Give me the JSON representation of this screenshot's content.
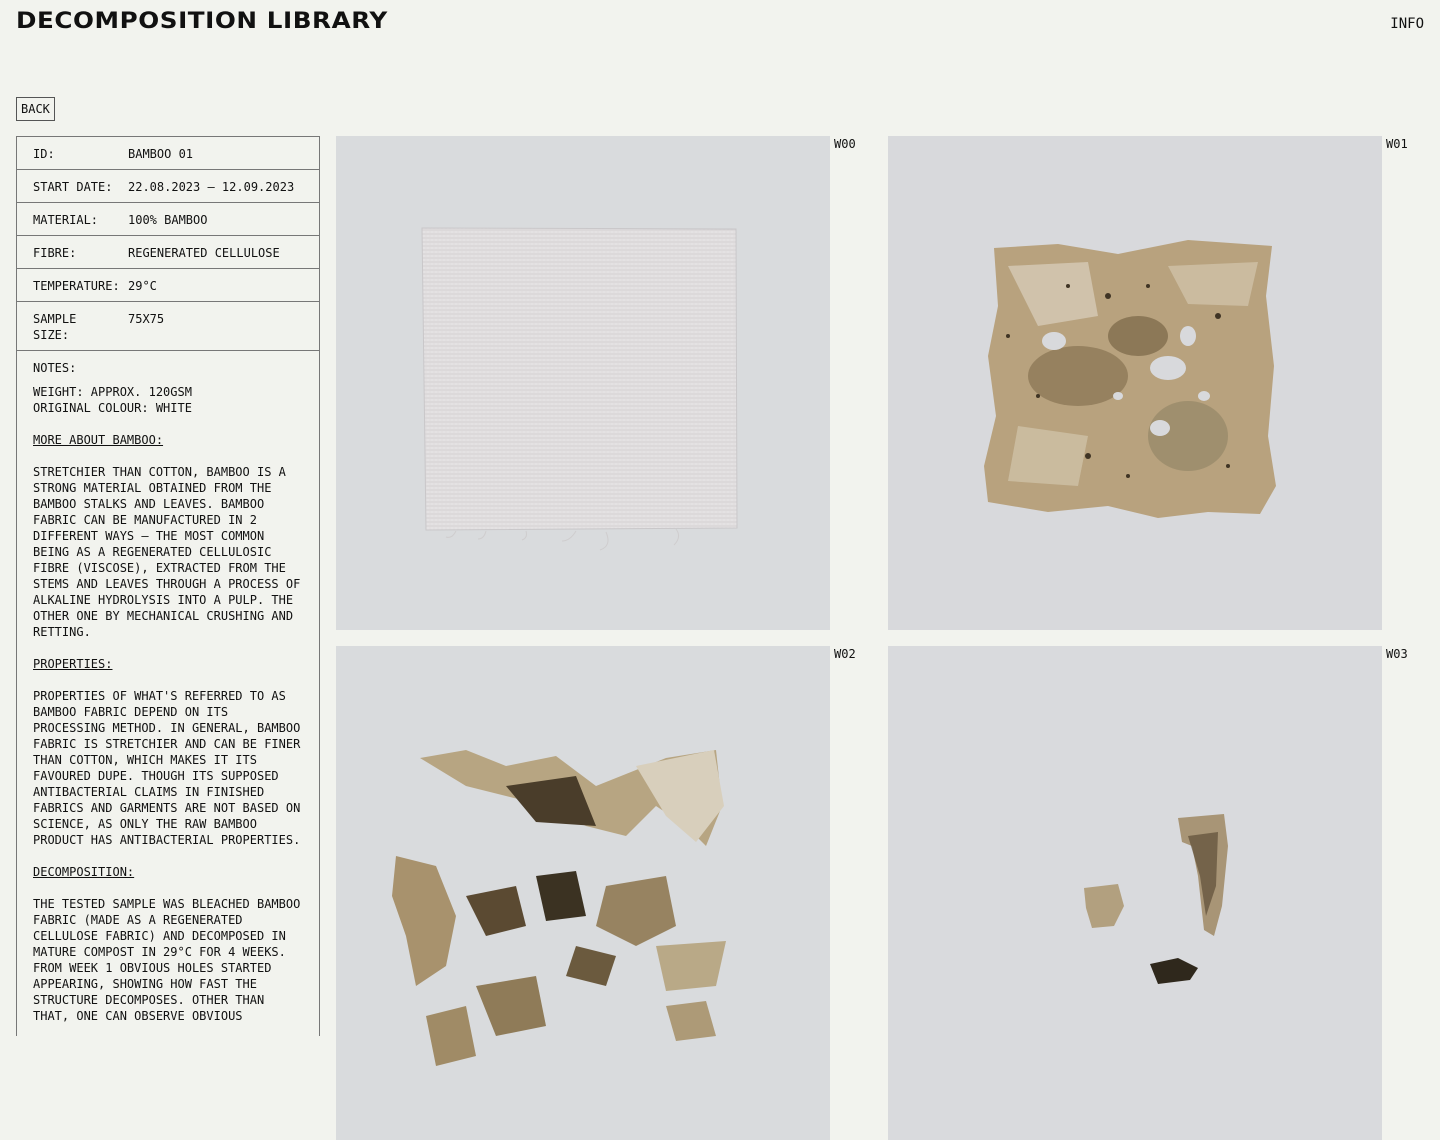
{
  "header": {
    "title": "DECOMPOSITION LIBRARY",
    "info_label": "INFO"
  },
  "nav": {
    "back_label": "BACK"
  },
  "sample": {
    "rows": [
      {
        "key": "ID:",
        "value": "BAMBOO 01"
      },
      {
        "key": "START DATE:",
        "value": "22.08.2023 – 12.09.2023"
      },
      {
        "key": "MATERIAL:",
        "value": "100% BAMBOO"
      },
      {
        "key": "FIBRE:",
        "value": "REGENERATED CELLULOSE"
      },
      {
        "key": "TEMPERATURE:",
        "value": "29°C"
      },
      {
        "key": "SAMPLE\nSIZE:",
        "value": "75X75"
      }
    ],
    "notes_label": "NOTES:",
    "notes_intro": "WEIGHT: APPROX. 120GSM\nORIGINAL COLOUR: WHITE",
    "sections": [
      {
        "heading": "MORE ABOUT BAMBOO:",
        "body": "STRETCHIER THAN COTTON, BAMBOO IS A STRONG MATERIAL OBTAINED FROM THE BAMBOO STALKS AND LEAVES. BAMBOO FABRIC CAN BE MANUFACTURED IN 2 DIFFERENT WAYS – THE MOST COMMON BEING AS A REGENERATED CELLULOSIC FIBRE (VISCOSE), EXTRACTED FROM THE STEMS AND LEAVES THROUGH A PROCESS OF ALKALINE HYDROLYSIS INTO A PULP. THE OTHER ONE BY MECHANICAL CRUSHING AND RETTING."
      },
      {
        "heading": "PROPERTIES:",
        "body": "PROPERTIES OF WHAT'S REFERRED TO AS BAMBOO FABRIC DEPEND ON ITS PROCESSING METHOD. IN GENERAL, BAMBOO FABRIC IS STRETCHIER AND CAN BE FINER THAN COTTON, WHICH MAKES IT ITS FAVOURED DUPE. THOUGH ITS SUPPOSED ANTIBACTERIAL CLAIMS IN FINISHED FABRICS AND GARMENTS ARE NOT BASED ON SCIENCE, AS ONLY THE RAW BAMBOO PRODUCT HAS ANTIBACTERIAL PROPERTIES."
      },
      {
        "heading": "DECOMPOSITION:",
        "body": "THE TESTED SAMPLE WAS BLEACHED BAMBOO FABRIC (MADE AS A REGENERATED CELLULOSE FABRIC) AND DECOMPOSED IN MATURE COMPOST IN 29°C FOR 4 WEEKS. FROM WEEK 1 OBVIOUS HOLES STARTED APPEARING, SHOWING HOW FAST THE STRUCTURE DECOMPOSES. OTHER THAN THAT, ONE CAN OBSERVE OBVIOUS"
      }
    ]
  },
  "gallery": {
    "weeks": [
      "W00",
      "W01",
      "W02",
      "W03"
    ]
  },
  "colors": {
    "background": "#f2f3ee",
    "photo_background": "#d9dbdd",
    "fabric_white": "#e3e1e2",
    "decay_brown": "#8a7552",
    "decay_dark": "#3b3222"
  }
}
